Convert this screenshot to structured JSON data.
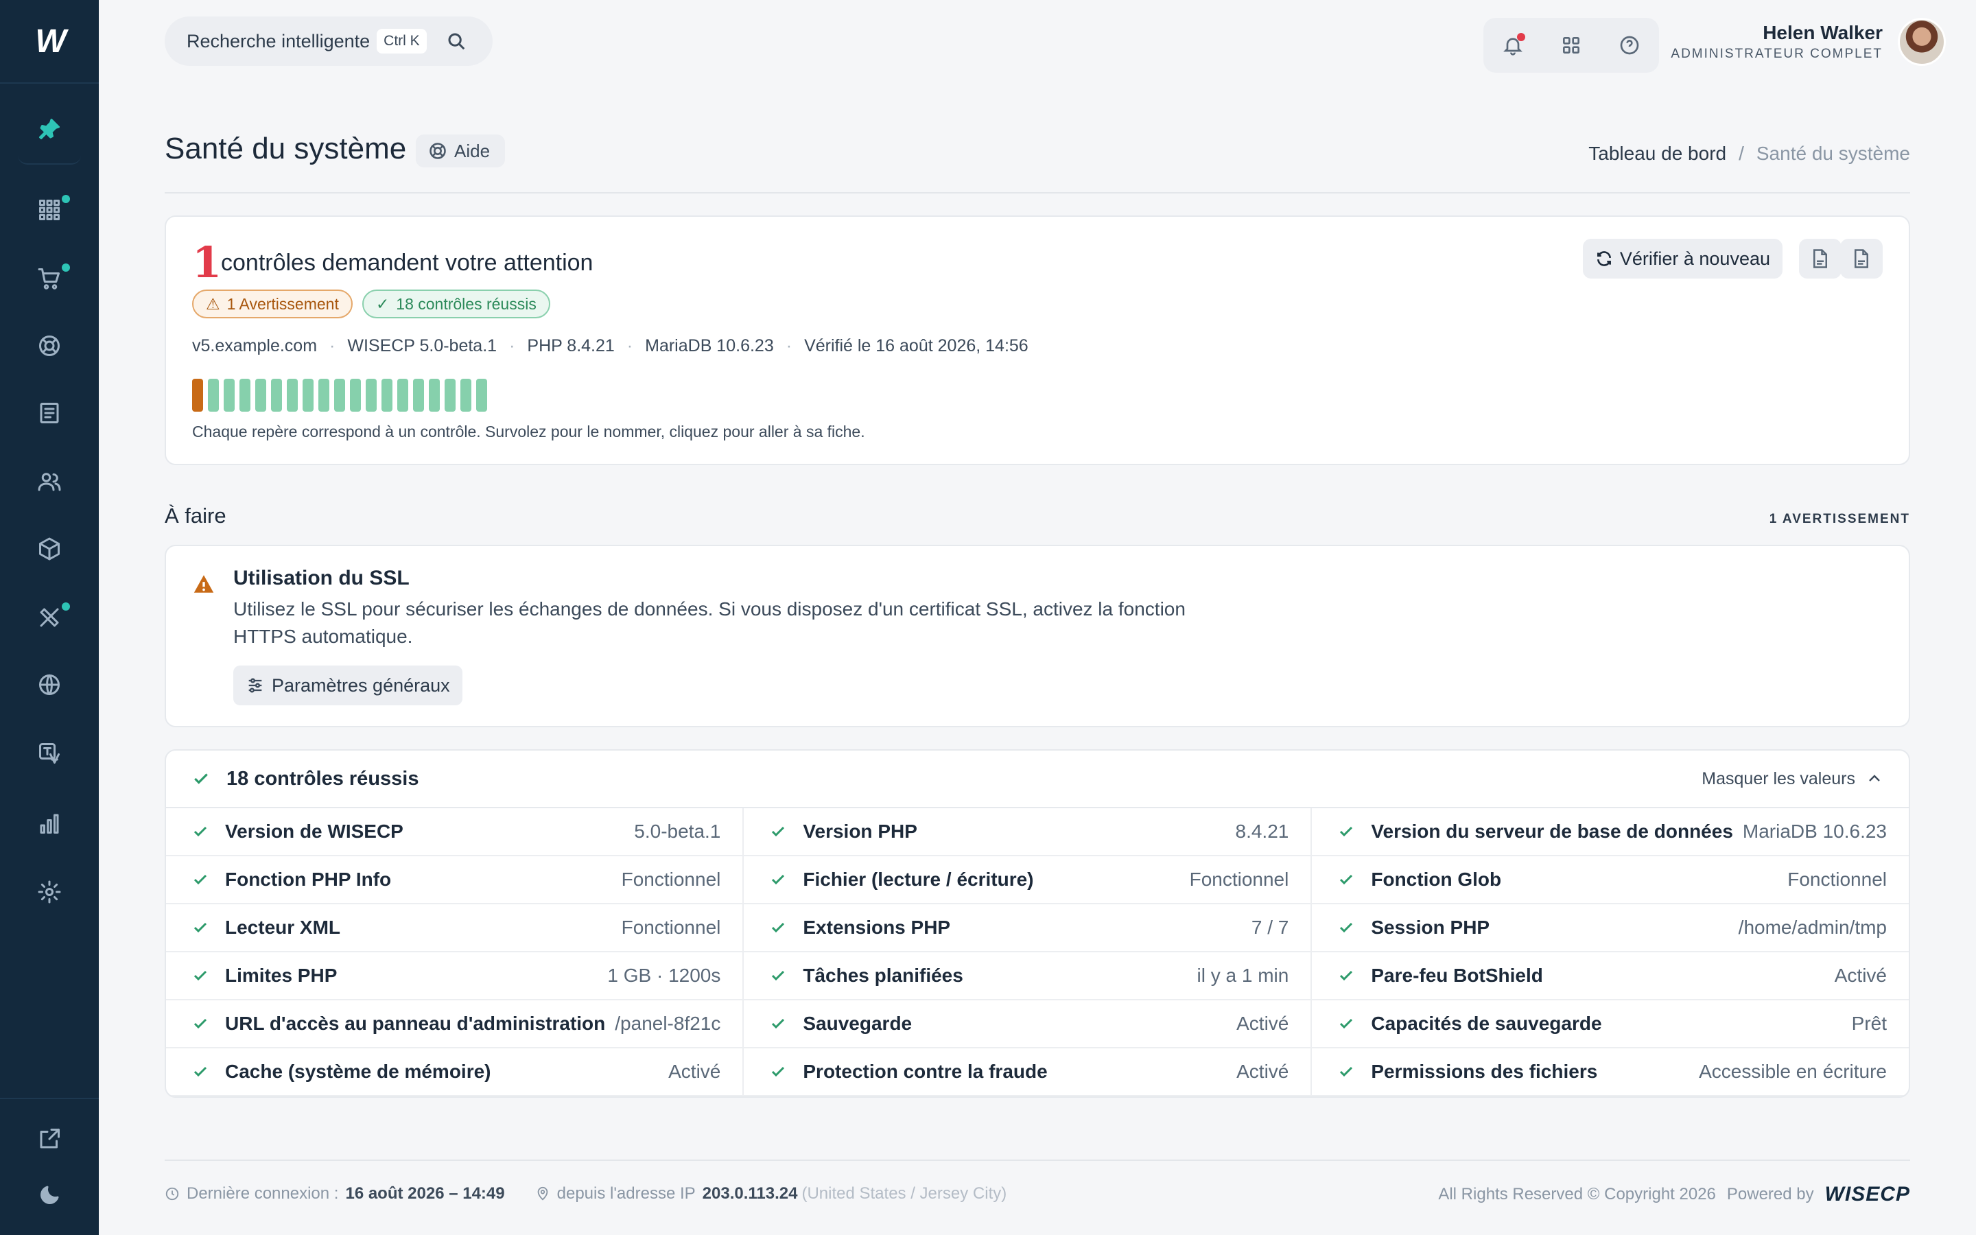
{
  "app": {
    "logo_text": "W"
  },
  "sidebar": {
    "items": [
      {
        "name": "pin",
        "icon": "pin-icon",
        "active": true
      },
      {
        "name": "dashboard",
        "icon": "apps-grid-icon",
        "badge": true
      },
      {
        "name": "orders",
        "icon": "cart-icon",
        "badge": true
      },
      {
        "name": "support",
        "icon": "lifebuoy-icon",
        "badge": false
      },
      {
        "name": "invoices",
        "icon": "invoice-icon",
        "badge": false
      },
      {
        "name": "clients",
        "icon": "users-icon",
        "badge": false
      },
      {
        "name": "products",
        "icon": "box-icon",
        "badge": false
      },
      {
        "name": "tools",
        "icon": "tools-icon",
        "badge": true
      },
      {
        "name": "domains",
        "icon": "globe-icon",
        "badge": false
      },
      {
        "name": "translate",
        "icon": "translate-icon",
        "badge": false
      },
      {
        "name": "reports",
        "icon": "bar-chart-icon",
        "badge": false
      },
      {
        "name": "settings",
        "icon": "gear-icon",
        "badge": false
      },
      {
        "name": "open-site",
        "icon": "external-link-icon",
        "badge": false
      },
      {
        "name": "theme",
        "icon": "moon-icon",
        "badge": false
      }
    ]
  },
  "topbar": {
    "search_placeholder": "Recherche intelligente",
    "search_shortcut": "Ctrl K",
    "user_name": "Helen Walker",
    "user_role": "ADMINISTRATEUR COMPLET"
  },
  "header": {
    "title": "Santé du système",
    "help_label": "Aide",
    "breadcrumb": {
      "home": "Tableau de bord",
      "separator": "/",
      "current": "Santé du système"
    }
  },
  "summary": {
    "count": "1",
    "title": "contrôles demandent votre attention",
    "warning_pill": "1 Avertissement",
    "passed_pill": "18 contrôles réussis",
    "meta": [
      "v5.example.com",
      "WISECP 5.0-beta.1",
      "PHP 8.4.21",
      "MariaDB 10.6.23",
      "Vérifié le 16 août 2026, 14:56"
    ],
    "meta_separator": "·",
    "ticks": [
      "warn",
      "ok",
      "ok",
      "ok",
      "ok",
      "ok",
      "ok",
      "ok",
      "ok",
      "ok",
      "ok",
      "ok",
      "ok",
      "ok",
      "ok",
      "ok",
      "ok",
      "ok",
      "ok"
    ],
    "legend": "Chaque repère correspond à un contrôle. Survolez pour le nommer, cliquez pour aller à sa fiche.",
    "recheck_label": "Vérifier à nouveau"
  },
  "todo": {
    "title": "À faire",
    "count_label": "1 AVERTISSEMENT",
    "item": {
      "heading": "Utilisation du SSL",
      "text": "Utilisez le SSL pour sécuriser les échanges de données. Si vous disposez d'un certificat SSL, activez la fonction HTTPS automatique.",
      "button": "Paramètres généraux"
    }
  },
  "passed": {
    "title": "18 contrôles réussis",
    "toggle_label": "Masquer les valeurs",
    "checks": [
      {
        "name": "Version de WISECP",
        "value": "5.0-beta.1"
      },
      {
        "name": "Version PHP",
        "value": "8.4.21"
      },
      {
        "name": "Version du serveur de base de données",
        "value": "MariaDB 10.6.23"
      },
      {
        "name": "Fonction PHP Info",
        "value": "Fonctionnel"
      },
      {
        "name": "Fichier (lecture / écriture)",
        "value": "Fonctionnel"
      },
      {
        "name": "Fonction Glob",
        "value": "Fonctionnel"
      },
      {
        "name": "Lecteur XML",
        "value": "Fonctionnel"
      },
      {
        "name": "Extensions PHP",
        "value": "7 / 7"
      },
      {
        "name": "Session PHP",
        "value": "/home/admin/tmp"
      },
      {
        "name": "Limites PHP",
        "value": "1 GB · 1200s"
      },
      {
        "name": "Tâches planifiées",
        "value": "il y a 1 min"
      },
      {
        "name": "Pare-feu BotShield",
        "value": "Activé"
      },
      {
        "name": "URL d'accès au panneau d'administration",
        "value": "/panel-8f21c"
      },
      {
        "name": "Sauvegarde",
        "value": "Activé"
      },
      {
        "name": "Capacités de sauvegarde",
        "value": "Prêt"
      },
      {
        "name": "Cache (système de mémoire)",
        "value": "Activé"
      },
      {
        "name": "Protection contre la fraude",
        "value": "Activé"
      },
      {
        "name": "Permissions des fichiers",
        "value": "Accessible en écriture"
      }
    ]
  },
  "footer": {
    "last_login_label": "Dernière connexion :",
    "last_login_value": "16 août 2026 – 14:49",
    "ip_label": "depuis l'adresse IP",
    "ip_value": "203.0.113.24",
    "ip_location": "(United States / Jersey City)",
    "copyright": "All Rights Reserved © Copyright 2026",
    "powered_by": "Powered by",
    "brand": "WISECP"
  },
  "colors": {
    "sidebar": "#13293d",
    "accent": "#2ec4b6",
    "danger": "#e23b4a",
    "warning": "#c86a16",
    "success": "#2c9a6a"
  }
}
